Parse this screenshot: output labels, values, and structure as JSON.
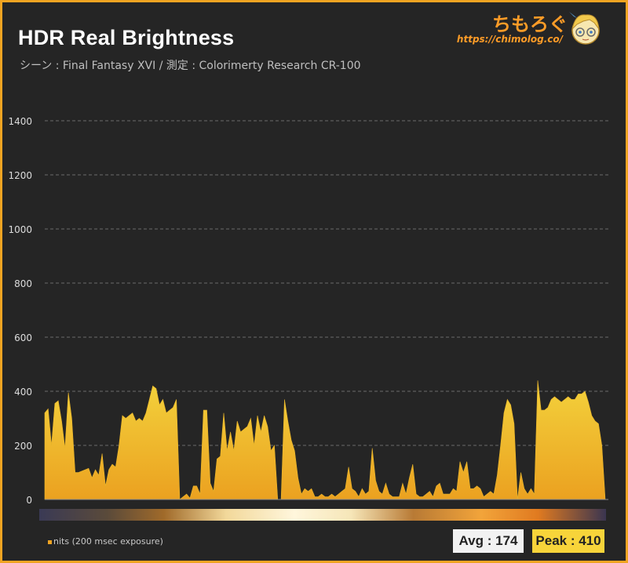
{
  "header": {
    "title": "HDR Real Brightness",
    "subtitle": "シーン : Final Fantasy XVI / 測定 : Colorimerty Research CR-100"
  },
  "brand": {
    "name": "ちもろぐ",
    "url": "https://chimolog.co/"
  },
  "legend": {
    "label": "nits (200 msec exposure)"
  },
  "stats": {
    "avg": "Avg : 174",
    "peak": "Peak : 410"
  },
  "colors": {
    "frame": "#f0a422",
    "background": "#252525",
    "area_top": "#f3d23c",
    "area_bottom": "#eba120",
    "accent": "#ff9c27"
  },
  "chart_data": {
    "type": "area",
    "title": "HDR Real Brightness",
    "xlabel": "",
    "ylabel": "",
    "ylim": [
      0,
      1400
    ],
    "yticks": [
      0,
      200,
      400,
      600,
      800,
      1000,
      1200,
      1400
    ],
    "grid": true,
    "legend_position": "bottom-left",
    "series": [
      {
        "name": "nits (200 msec exposure)",
        "values": [
          320,
          335,
          200,
          355,
          365,
          290,
          190,
          395,
          300,
          100,
          100,
          105,
          110,
          115,
          80,
          110,
          90,
          170,
          50,
          110,
          130,
          120,
          200,
          310,
          300,
          310,
          320,
          290,
          300,
          290,
          320,
          370,
          420,
          410,
          350,
          370,
          320,
          330,
          340,
          370,
          0,
          10,
          20,
          5,
          50,
          50,
          20,
          330,
          330,
          60,
          30,
          150,
          160,
          320,
          180,
          250,
          180,
          290,
          250,
          260,
          270,
          300,
          200,
          310,
          250,
          310,
          270,
          180,
          200,
          0,
          0,
          370,
          290,
          220,
          180,
          80,
          20,
          40,
          30,
          40,
          10,
          10,
          20,
          10,
          10,
          20,
          10,
          20,
          30,
          40,
          120,
          40,
          30,
          10,
          40,
          20,
          30,
          190,
          70,
          30,
          20,
          60,
          20,
          10,
          10,
          10,
          60,
          20,
          80,
          130,
          20,
          10,
          10,
          20,
          30,
          10,
          50,
          60,
          20,
          20,
          20,
          40,
          30,
          140,
          100,
          140,
          40,
          40,
          50,
          40,
          10,
          20,
          30,
          20,
          90,
          200,
          320,
          370,
          350,
          280,
          0,
          100,
          40,
          20,
          40,
          20,
          440,
          330,
          330,
          340,
          370,
          380,
          370,
          360,
          370,
          380,
          370,
          370,
          390,
          390,
          400,
          360,
          310,
          290,
          280,
          200,
          0
        ]
      }
    ],
    "avg": 174,
    "peak": 410
  }
}
